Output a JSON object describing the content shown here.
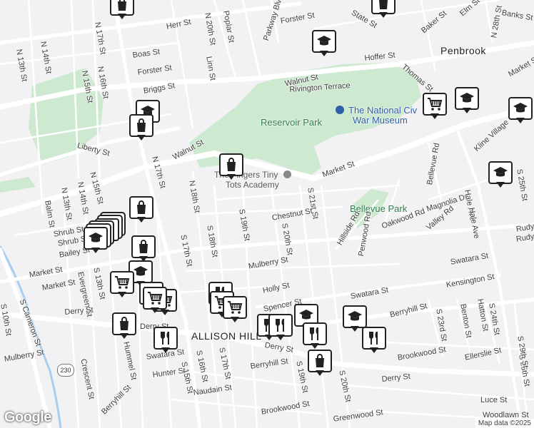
{
  "map": {
    "colors": {
      "background": "#f2f2f4",
      "park": "#cde9cf",
      "road": "#ffffff",
      "river": "#a7cdf2",
      "pin_border": "#222222"
    },
    "areas": [
      {
        "id": "penbrook",
        "label": "Penbrook"
      },
      {
        "id": "allison-hill",
        "label": "ALLISON HILL"
      }
    ],
    "parks": [
      {
        "id": "reservoir-park",
        "label": "Reservoir Park"
      },
      {
        "id": "bellevue-park",
        "label": "Bellevue Park"
      }
    ],
    "poi": {
      "museum_line1": "The National Civ",
      "museum_line2": "War Museum",
      "academy_line1": "The Fingers Tiny",
      "academy_line2": "Tots Academy"
    },
    "streets": [
      {
        "name": "N 17th St"
      },
      {
        "name": "Herr St"
      },
      {
        "name": "N 20th St"
      },
      {
        "name": "Poplar St"
      },
      {
        "name": "Parkway Blvd"
      },
      {
        "name": "Forster St"
      },
      {
        "name": "State St"
      },
      {
        "name": "Baker St"
      },
      {
        "name": "Elm St"
      },
      {
        "name": "N 28th St"
      },
      {
        "name": "Banks St"
      },
      {
        "name": "N 13th St"
      },
      {
        "name": "N 14th St"
      },
      {
        "name": "Boas St"
      },
      {
        "name": "Forster St"
      },
      {
        "name": "Linn St"
      },
      {
        "name": "Hoffer St"
      },
      {
        "name": "N 16th St"
      },
      {
        "name": "N 15th St"
      },
      {
        "name": "Briggs St"
      },
      {
        "name": "Walnut St"
      },
      {
        "name": "Thomas St"
      },
      {
        "name": "Rivington Terrace"
      },
      {
        "name": "Market St"
      },
      {
        "name": "Liberty St"
      },
      {
        "name": "Walnut St"
      },
      {
        "name": "N 17th St"
      },
      {
        "name": "Kline Village"
      },
      {
        "name": "N 15th St"
      },
      {
        "name": "N 18th St"
      },
      {
        "name": "Market St"
      },
      {
        "name": "Bellevue Rd"
      },
      {
        "name": "S 25th St"
      },
      {
        "name": "Balm St"
      },
      {
        "name": "N 13th St"
      },
      {
        "name": "N 14th St"
      },
      {
        "name": "S 21st St"
      },
      {
        "name": "Chestnut St"
      },
      {
        "name": "Magnolia Dr"
      },
      {
        "name": "Hale Ave"
      },
      {
        "name": "S 19th St"
      },
      {
        "name": "Oakwood Rd"
      },
      {
        "name": "Valley Rd"
      },
      {
        "name": "Shrub St"
      },
      {
        "name": "Hillside Rd"
      },
      {
        "name": "Penwood Rd"
      },
      {
        "name": "Rudy Rd"
      },
      {
        "name": "Bailey St"
      },
      {
        "name": "S 18th St"
      },
      {
        "name": "S 20th St"
      },
      {
        "name": "S 17th St"
      },
      {
        "name": "Market St"
      },
      {
        "name": "Mulberry St"
      },
      {
        "name": "Swatara St"
      },
      {
        "name": "S 13th St"
      },
      {
        "name": "Evergreen St"
      },
      {
        "name": "Kensington St"
      },
      {
        "name": "Holly St"
      },
      {
        "name": "Swatara St"
      },
      {
        "name": "S Cameron St"
      },
      {
        "name": "Spencer St"
      },
      {
        "name": "Derry St"
      },
      {
        "name": "Berryhill St"
      },
      {
        "name": "Hatton St"
      },
      {
        "name": "S 10th St"
      },
      {
        "name": "Benton St"
      },
      {
        "name": "S 24th St"
      },
      {
        "name": "S 23rd St"
      },
      {
        "name": "Mulberry St"
      },
      {
        "name": "Derry St"
      },
      {
        "name": "Hummel St"
      },
      {
        "name": "Crescent St"
      },
      {
        "name": "Swatara St"
      },
      {
        "name": "S 16th St"
      },
      {
        "name": "S 17th St"
      },
      {
        "name": "Brookwood St"
      },
      {
        "name": "Hunter St"
      },
      {
        "name": "S 15th St"
      },
      {
        "name": "Berryhill St"
      },
      {
        "name": "Ellerslie St"
      },
      {
        "name": "Derry St"
      },
      {
        "name": "Naudain St"
      },
      {
        "name": "S 19th St"
      },
      {
        "name": "S 20th St"
      },
      {
        "name": "Luce St"
      },
      {
        "name": "Brookwood St"
      },
      {
        "name": "Greenwood St"
      },
      {
        "name": "Woodlawn St"
      },
      {
        "name": "S 25th St"
      },
      {
        "name": "Berryhill St"
      },
      {
        "name": "Market St"
      },
      {
        "name": "S 29th St"
      },
      {
        "name": "Derry St"
      },
      {
        "name": "Rudy Rd"
      },
      {
        "name": "Hale Ave"
      },
      {
        "name": "Shrub St"
      }
    ],
    "route_shield": "230",
    "pins": [
      {
        "type": "shopping-bag"
      },
      {
        "type": "shopping-bag"
      },
      {
        "type": "school"
      },
      {
        "type": "school"
      },
      {
        "type": "school"
      },
      {
        "type": "shopping-bag"
      },
      {
        "type": "school"
      },
      {
        "type": "grocery-cart"
      },
      {
        "type": "school"
      },
      {
        "type": "shopping-bag"
      },
      {
        "type": "school"
      },
      {
        "type": "shopping-bag"
      },
      {
        "type": "shopping-bag"
      },
      {
        "type": "shopping-bag"
      },
      {
        "type": "school"
      },
      {
        "type": "grocery-cart"
      },
      {
        "type": "grocery-cart"
      },
      {
        "type": "grocery-cart"
      },
      {
        "type": "restaurant"
      },
      {
        "type": "grocery-cart"
      },
      {
        "type": "grocery-cart"
      },
      {
        "type": "shopping-bag"
      },
      {
        "type": "restaurant"
      },
      {
        "type": "restaurant"
      },
      {
        "type": "restaurant"
      },
      {
        "type": "school"
      },
      {
        "type": "restaurant"
      },
      {
        "type": "school"
      },
      {
        "type": "restaurant"
      },
      {
        "type": "shopping-bag"
      },
      {
        "type": "grocery-cart"
      }
    ],
    "footer": {
      "logo": "Google",
      "attribution": "Map data ©2025"
    }
  }
}
